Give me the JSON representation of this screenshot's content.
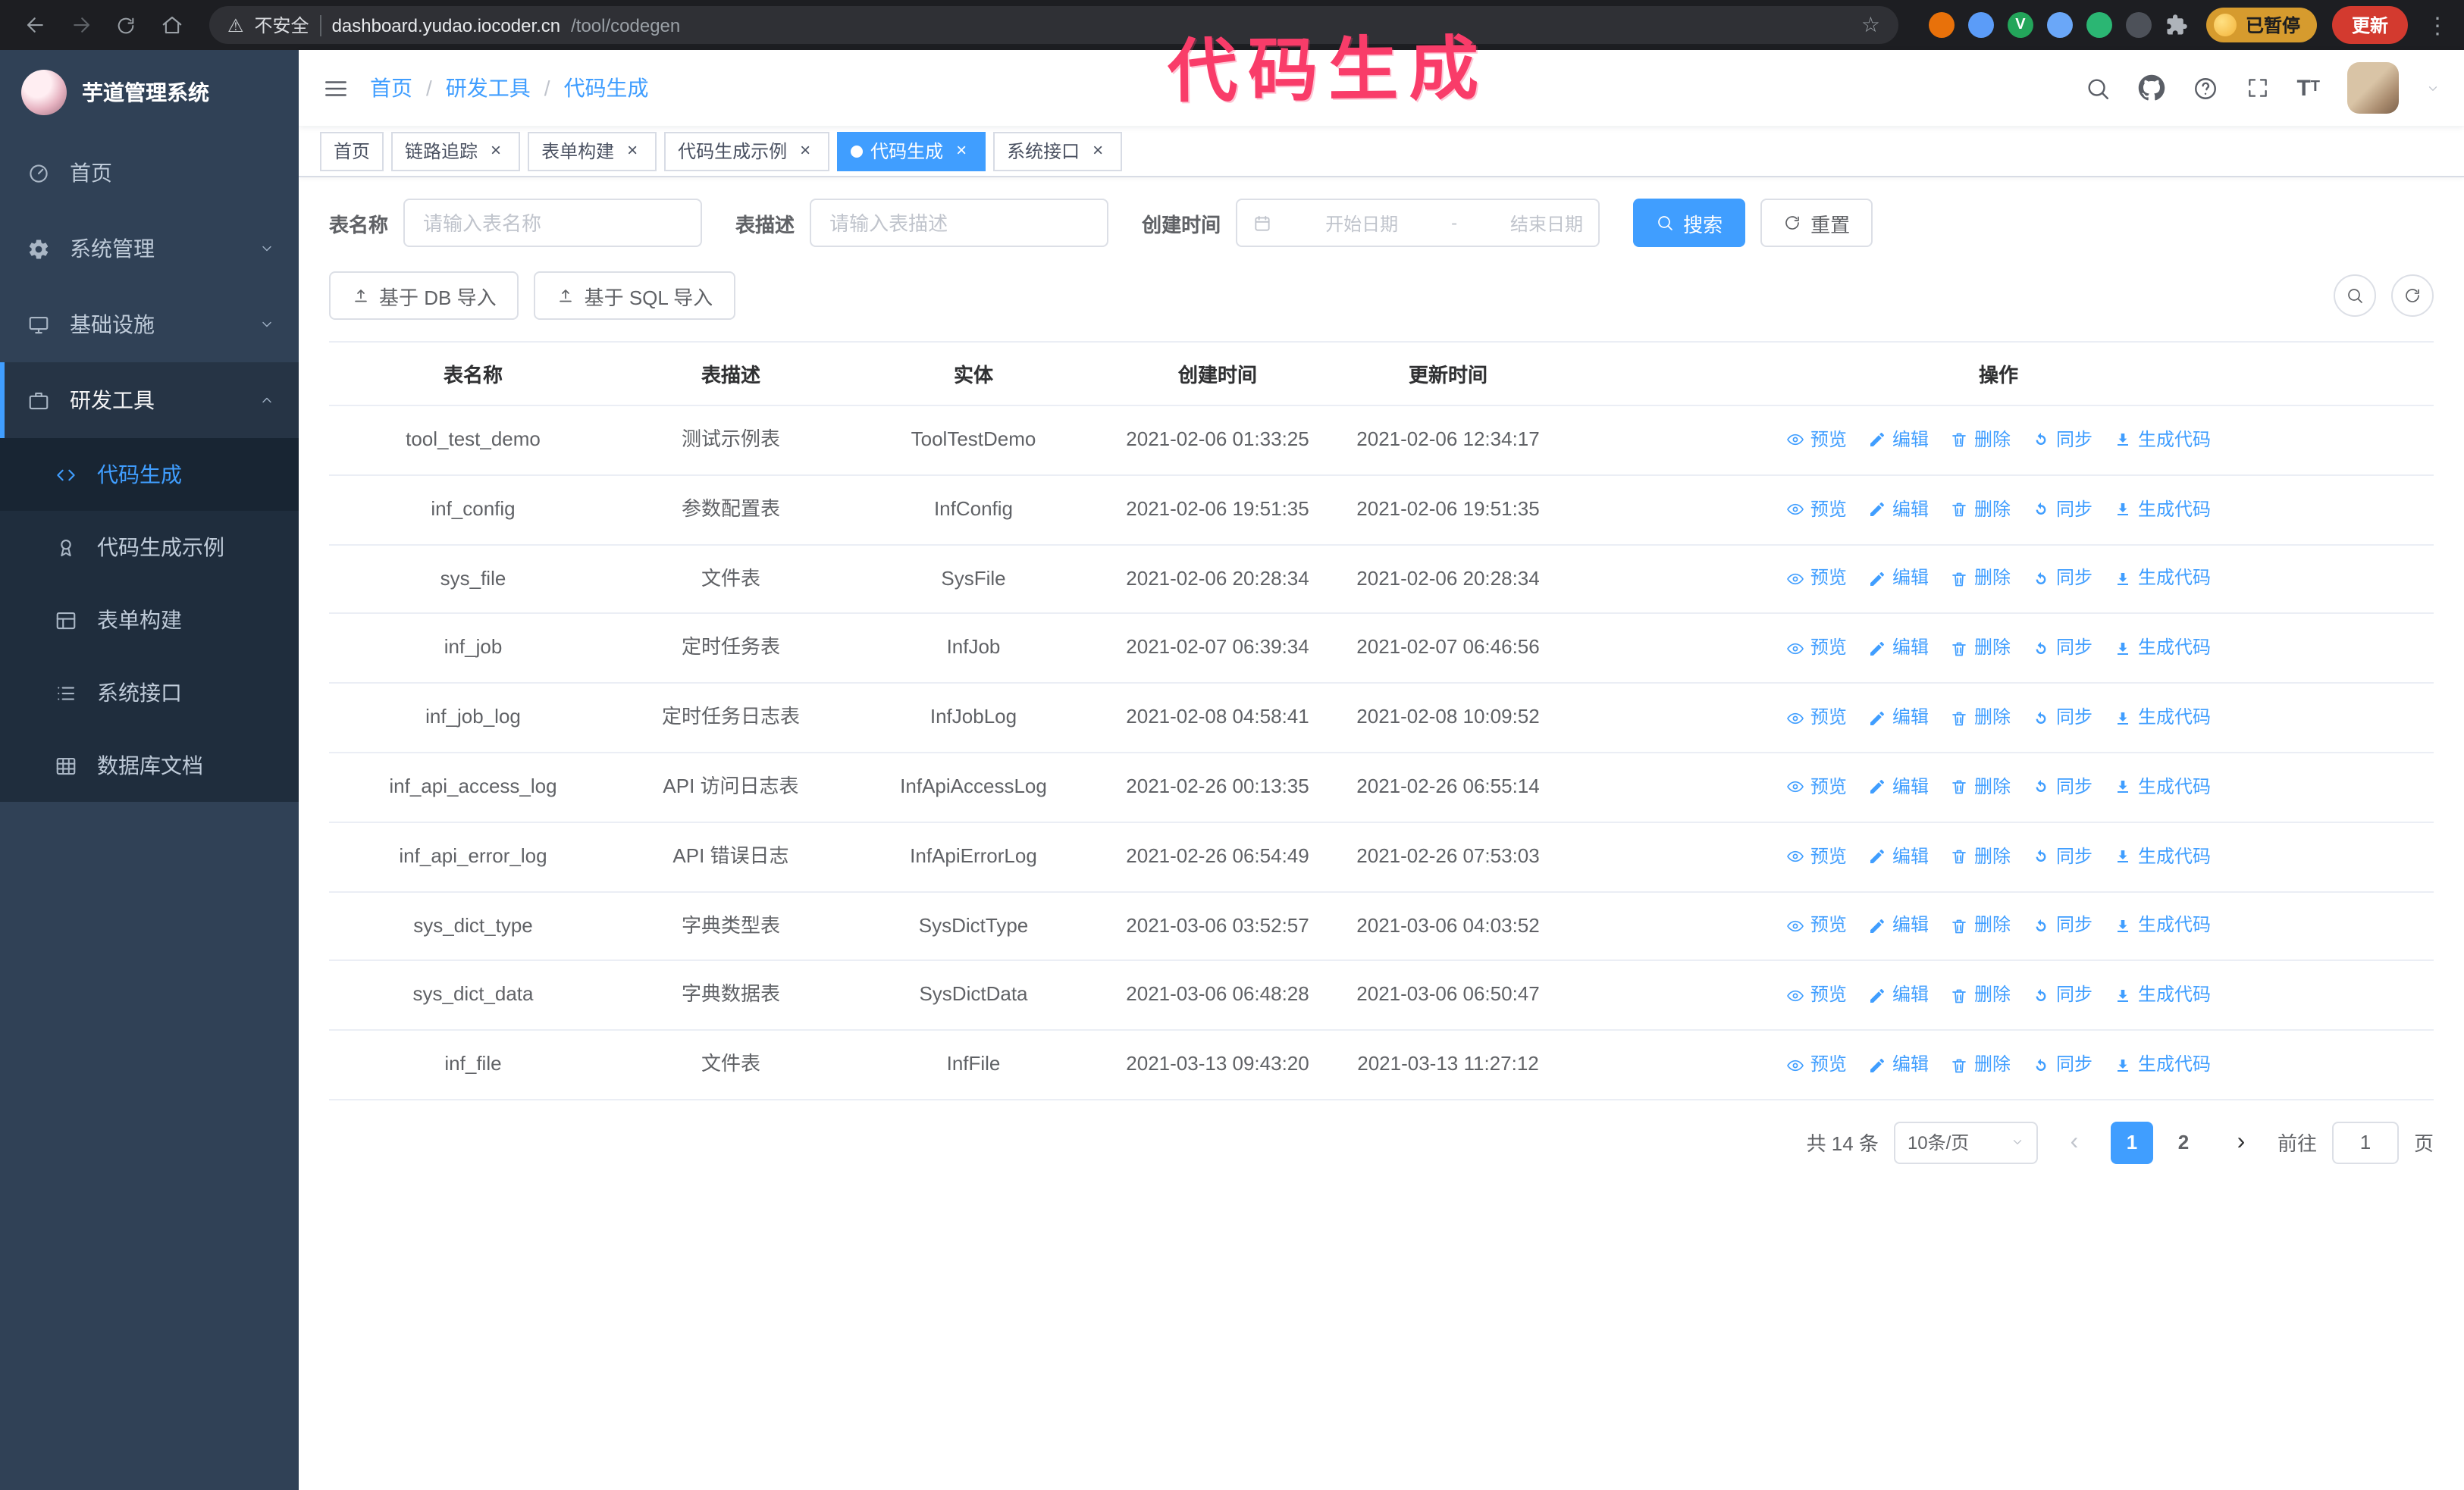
{
  "browser": {
    "security": "不安全",
    "url_host": "dashboard.yudao.iocoder.cn",
    "url_path": "/tool/codegen",
    "paused": "已暂停",
    "update": "更新",
    "extensions": [
      {
        "color": "#e8710a"
      },
      {
        "color": "#5b9cf8"
      },
      {
        "color": "#23a55a",
        "glyph": "V"
      },
      {
        "color": "#6aa7f8"
      },
      {
        "color": "#2bb673"
      },
      {
        "color": "#4d5159"
      },
      {
        "color": "#aeb3ba",
        "puzzle": true
      }
    ]
  },
  "annotation": {
    "text": "代码生成",
    "color": "#f93c69"
  },
  "colors": {
    "accent": "#409eff",
    "sidebar_bg": "#304156",
    "submenu_bg": "#1f2d3d"
  },
  "sidebar": {
    "title": "芋道管理系统",
    "menu": [
      {
        "key": "home",
        "label": "首页",
        "icon": "dashboard-icon"
      },
      {
        "key": "system",
        "label": "系统管理",
        "icon": "gear-icon",
        "caret": "down"
      },
      {
        "key": "infra",
        "label": "基础设施",
        "icon": "infra-icon",
        "caret": "down"
      },
      {
        "key": "devtools",
        "label": "研发工具",
        "icon": "tools-icon",
        "caret": "up",
        "active": true
      }
    ],
    "submenu": [
      {
        "key": "codegen",
        "label": "代码生成",
        "icon": "code-icon",
        "active": true
      },
      {
        "key": "codegen-example",
        "label": "代码生成示例",
        "icon": "example-icon"
      },
      {
        "key": "form-build",
        "label": "表单构建",
        "icon": "form-icon"
      },
      {
        "key": "api",
        "label": "系统接口",
        "icon": "api-icon"
      },
      {
        "key": "db-doc",
        "label": "数据库文档",
        "icon": "db-doc-icon"
      }
    ]
  },
  "navbar": {
    "breadcrumb": [
      "首页",
      "研发工具",
      "代码生成"
    ]
  },
  "tabs": [
    {
      "key": "home",
      "label": "首页",
      "closable": false,
      "active": false
    },
    {
      "key": "tracer",
      "label": "链路追踪",
      "closable": true,
      "active": false
    },
    {
      "key": "form-build",
      "label": "表单构建",
      "closable": true,
      "active": false
    },
    {
      "key": "codegen-example",
      "label": "代码生成示例",
      "closable": true,
      "active": false
    },
    {
      "key": "codegen",
      "label": "代码生成",
      "closable": true,
      "active": true
    },
    {
      "key": "api",
      "label": "系统接口",
      "closable": true,
      "active": false
    }
  ],
  "filters": {
    "table_name_label": "表名称",
    "table_name_placeholder": "请输入表名称",
    "table_desc_label": "表描述",
    "table_desc_placeholder": "请输入表描述",
    "create_time_label": "创建时间",
    "date_start_placeholder": "开始日期",
    "date_separator": "-",
    "date_end_placeholder": "结束日期",
    "search_button": "搜索",
    "reset_button": "重置"
  },
  "toolbar": {
    "import_db": "基于 DB 导入",
    "import_sql": "基于 SQL 导入"
  },
  "table": {
    "columns": [
      "表名称",
      "表描述",
      "实体",
      "创建时间",
      "更新时间",
      "操作"
    ],
    "row_actions": [
      "预览",
      "编辑",
      "删除",
      "同步",
      "生成代码"
    ],
    "rows": [
      {
        "name": "tool_test_demo",
        "desc": "测试示例表",
        "entity": "ToolTestDemo",
        "created": "2021-02-06 01:33:25",
        "updated": "2021-02-06 12:34:17"
      },
      {
        "name": "inf_config",
        "desc": "参数配置表",
        "entity": "InfConfig",
        "created": "2021-02-06 19:51:35",
        "updated": "2021-02-06 19:51:35"
      },
      {
        "name": "sys_file",
        "desc": "文件表",
        "entity": "SysFile",
        "created": "2021-02-06 20:28:34",
        "updated": "2021-02-06 20:28:34"
      },
      {
        "name": "inf_job",
        "desc": "定时任务表",
        "entity": "InfJob",
        "created": "2021-02-07 06:39:34",
        "updated": "2021-02-07 06:46:56"
      },
      {
        "name": "inf_job_log",
        "desc": "定时任务日志表",
        "entity": "InfJobLog",
        "created": "2021-02-08 04:58:41",
        "updated": "2021-02-08 10:09:52"
      },
      {
        "name": "inf_api_access_log",
        "desc": "API 访问日志表",
        "entity": "InfApiAccessLog",
        "created": "2021-02-26 00:13:35",
        "updated": "2021-02-26 06:55:14"
      },
      {
        "name": "inf_api_error_log",
        "desc": "API 错误日志",
        "entity": "InfApiErrorLog",
        "created": "2021-02-26 06:54:49",
        "updated": "2021-02-26 07:53:03"
      },
      {
        "name": "sys_dict_type",
        "desc": "字典类型表",
        "entity": "SysDictType",
        "created": "2021-03-06 03:52:57",
        "updated": "2021-03-06 04:03:52"
      },
      {
        "name": "sys_dict_data",
        "desc": "字典数据表",
        "entity": "SysDictData",
        "created": "2021-03-06 06:48:28",
        "updated": "2021-03-06 06:50:47"
      },
      {
        "name": "inf_file",
        "desc": "文件表",
        "entity": "InfFile",
        "created": "2021-03-13 09:43:20",
        "updated": "2021-03-13 11:27:12"
      }
    ]
  },
  "pagination": {
    "total": "共 14 条",
    "page_size": "10条/页",
    "pages": [
      "1",
      "2"
    ],
    "current": "1",
    "goto_label": "前往",
    "goto_value": "1",
    "page_suffix": "页"
  }
}
